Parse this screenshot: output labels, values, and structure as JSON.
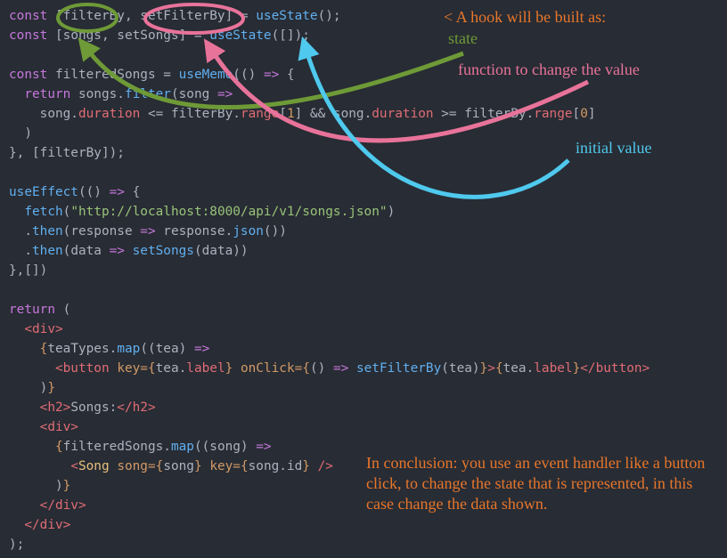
{
  "code_lines": [
    [
      [
        "kw",
        "const"
      ],
      [
        "plain",
        " [filterBy, setFilterBy] = "
      ],
      [
        "fn",
        "useState"
      ],
      [
        "plain",
        "();"
      ]
    ],
    [
      [
        "kw",
        "const"
      ],
      [
        "plain",
        " [songs, setSongs] = "
      ],
      [
        "fn",
        "useState"
      ],
      [
        "plain",
        "([]);"
      ]
    ],
    [],
    [
      [
        "kw",
        "const"
      ],
      [
        "plain",
        " filteredSongs = "
      ],
      [
        "fn",
        "useMemo"
      ],
      [
        "plain",
        "(() "
      ],
      [
        "kw",
        "=>"
      ],
      [
        "plain",
        " {"
      ]
    ],
    [
      [
        "plain",
        "  "
      ],
      [
        "kw",
        "return"
      ],
      [
        "plain",
        " songs."
      ],
      [
        "fn",
        "filter"
      ],
      [
        "plain",
        "(song "
      ],
      [
        "kw",
        "=>"
      ]
    ],
    [
      [
        "plain",
        "    song."
      ],
      [
        "var",
        "duration"
      ],
      [
        "plain",
        " <= filterBy."
      ],
      [
        "var",
        "range"
      ],
      [
        "plain",
        "["
      ],
      [
        "attr",
        "1"
      ],
      [
        "plain",
        "] && song."
      ],
      [
        "var",
        "duration"
      ],
      [
        "plain",
        " >= filterBy."
      ],
      [
        "var",
        "range"
      ],
      [
        "plain",
        "["
      ],
      [
        "attr",
        "0"
      ],
      [
        "plain",
        "]"
      ]
    ],
    [
      [
        "plain",
        "  )"
      ]
    ],
    [
      [
        "plain",
        "}, [filterBy]);"
      ]
    ],
    [],
    [
      [
        "fn",
        "useEffect"
      ],
      [
        "plain",
        "(() "
      ],
      [
        "kw",
        "=>"
      ],
      [
        "plain",
        " {"
      ]
    ],
    [
      [
        "plain",
        "  "
      ],
      [
        "fn",
        "fetch"
      ],
      [
        "plain",
        "("
      ],
      [
        "str",
        "\"http://localhost:8000/api/v1/songs.json\""
      ],
      [
        "plain",
        ")"
      ]
    ],
    [
      [
        "plain",
        "  ."
      ],
      [
        "fn",
        "then"
      ],
      [
        "plain",
        "(response "
      ],
      [
        "kw",
        "=>"
      ],
      [
        "plain",
        " response."
      ],
      [
        "fn",
        "json"
      ],
      [
        "plain",
        "())"
      ]
    ],
    [
      [
        "plain",
        "  ."
      ],
      [
        "fn",
        "then"
      ],
      [
        "plain",
        "(data "
      ],
      [
        "kw",
        "=>"
      ],
      [
        "plain",
        " "
      ],
      [
        "fn",
        "setSongs"
      ],
      [
        "plain",
        "(data))"
      ]
    ],
    [
      [
        "plain",
        "},[])"
      ]
    ],
    [],
    [
      [
        "kw",
        "return"
      ],
      [
        "plain",
        " ("
      ]
    ],
    [
      [
        "plain",
        "  "
      ],
      [
        "tag",
        "<div>"
      ]
    ],
    [
      [
        "plain",
        "    "
      ],
      [
        "attr",
        "{"
      ],
      [
        "plain",
        "teaTypes."
      ],
      [
        "fn",
        "map"
      ],
      [
        "plain",
        "((tea) "
      ],
      [
        "kw",
        "=>"
      ]
    ],
    [
      [
        "plain",
        "      "
      ],
      [
        "tag",
        "<button"
      ],
      [
        "plain",
        " "
      ],
      [
        "attr",
        "key="
      ],
      [
        "attr",
        "{"
      ],
      [
        "plain",
        "tea."
      ],
      [
        "var",
        "label"
      ],
      [
        "attr",
        "}"
      ],
      [
        "plain",
        " "
      ],
      [
        "attr",
        "onClick="
      ],
      [
        "attr",
        "{"
      ],
      [
        "plain",
        "() "
      ],
      [
        "kw",
        "=>"
      ],
      [
        "plain",
        " "
      ],
      [
        "fn",
        "setFilterBy"
      ],
      [
        "plain",
        "(tea)"
      ],
      [
        "attr",
        "}"
      ],
      [
        "tag",
        ">"
      ],
      [
        "attr",
        "{"
      ],
      [
        "plain",
        "tea."
      ],
      [
        "var",
        "label"
      ],
      [
        "attr",
        "}"
      ],
      [
        "tag",
        "</button>"
      ]
    ],
    [
      [
        "plain",
        "    )"
      ],
      [
        "attr",
        "}"
      ]
    ],
    [
      [
        "plain",
        "    "
      ],
      [
        "tag",
        "<h2>"
      ],
      [
        "plain",
        "Songs:"
      ],
      [
        "tag",
        "</h2>"
      ]
    ],
    [
      [
        "plain",
        "    "
      ],
      [
        "tag",
        "<div>"
      ]
    ],
    [
      [
        "plain",
        "      "
      ],
      [
        "attr",
        "{"
      ],
      [
        "plain",
        "filteredSongs."
      ],
      [
        "fn",
        "map"
      ],
      [
        "plain",
        "((song) "
      ],
      [
        "kw",
        "=>"
      ]
    ],
    [
      [
        "plain",
        "        "
      ],
      [
        "tag",
        "<"
      ],
      [
        "cls",
        "Song"
      ],
      [
        "plain",
        " "
      ],
      [
        "attr",
        "song="
      ],
      [
        "attr",
        "{"
      ],
      [
        "plain",
        "song"
      ],
      [
        "attr",
        "}"
      ],
      [
        "plain",
        " "
      ],
      [
        "attr",
        "key="
      ],
      [
        "attr",
        "{"
      ],
      [
        "plain",
        "song.id"
      ],
      [
        "attr",
        "}"
      ],
      [
        "plain",
        " "
      ],
      [
        "tag",
        "/>"
      ]
    ],
    [
      [
        "plain",
        "      )"
      ],
      [
        "attr",
        "}"
      ]
    ],
    [
      [
        "plain",
        "    "
      ],
      [
        "tag",
        "</div>"
      ]
    ],
    [
      [
        "plain",
        "  "
      ],
      [
        "tag",
        "</div>"
      ]
    ],
    [
      [
        "plain",
        ");"
      ]
    ]
  ],
  "annotations": {
    "hook_title": "< A hook will be built as:",
    "state": "state",
    "function_label": "function to change the value",
    "initial_value": "initial value",
    "conclusion": "In conclusion: you use an event handler like a button click, to change the state that is represented, in this case change the data shown."
  },
  "colors": {
    "background": "#282c34",
    "green": "#6e9a37",
    "pink": "#e8739a",
    "blue": "#4fc9ee",
    "orange": "#e8762b"
  }
}
